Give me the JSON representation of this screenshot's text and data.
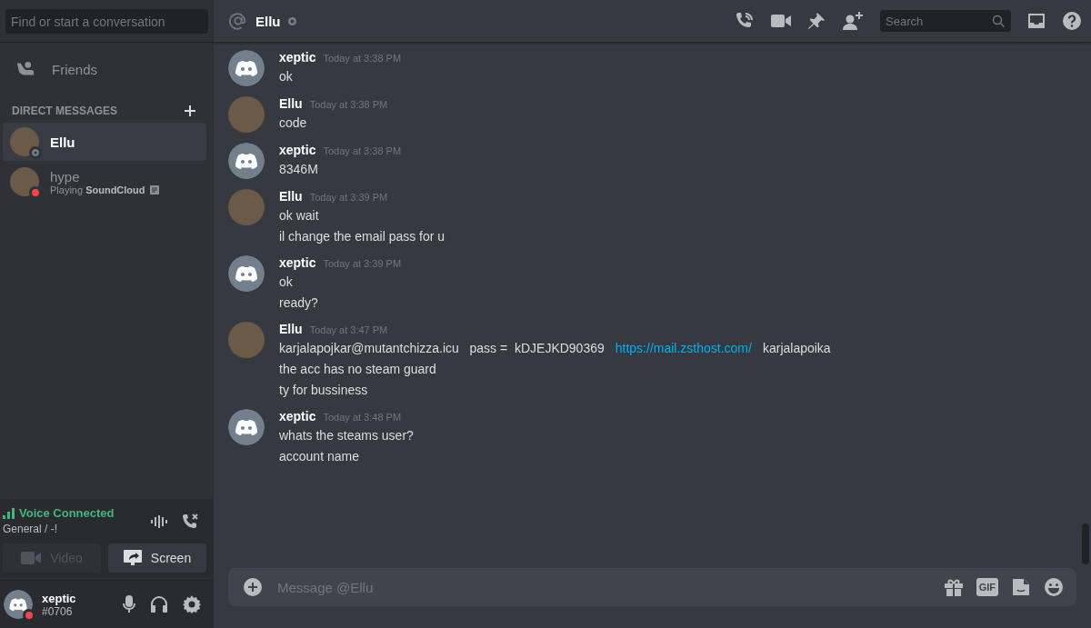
{
  "sidebar": {
    "search": {
      "placeholder": "Find or start a conversation"
    },
    "friends": {
      "label": "Friends",
      "selected": false
    },
    "dm_heading": "DIRECT MESSAGES",
    "dms": [
      {
        "name": "Ellu",
        "offline": true,
        "dnd": false,
        "selected": true
      },
      {
        "name": "hype",
        "offline": false,
        "dnd": true,
        "selected": false,
        "activity_prefix": "Playing",
        "activity": "SoundCloud"
      }
    ],
    "voice": {
      "title": "Voice Connected",
      "channel": "General / -!",
      "buttons": [
        {
          "label": "Video",
          "kind": "video",
          "disabled": true
        },
        {
          "label": "Screen",
          "kind": "screen",
          "disabled": false
        }
      ]
    },
    "user": {
      "name": "xeptic",
      "tag": "#0706",
      "dnd": true
    }
  },
  "header": {
    "name": "Ellu",
    "offline": true,
    "search_placeholder": "Search"
  },
  "messages": [
    {
      "author": "xeptic",
      "photo_avatar": false,
      "time": "Today at 3:38 PM",
      "lines": [
        {
          "text": "ok"
        }
      ]
    },
    {
      "author": "Ellu",
      "photo_avatar": true,
      "time": "Today at 3:38 PM",
      "lines": [
        {
          "text": "code"
        }
      ]
    },
    {
      "author": "xeptic",
      "photo_avatar": false,
      "time": "Today at 3:38 PM",
      "lines": [
        {
          "text": "8346M"
        }
      ]
    },
    {
      "author": "Ellu",
      "photo_avatar": true,
      "time": "Today at 3:39 PM",
      "lines": [
        {
          "text": "ok wait"
        },
        {
          "text": "il change the email pass for u"
        }
      ]
    },
    {
      "author": "xeptic",
      "photo_avatar": false,
      "time": "Today at 3:39 PM",
      "lines": [
        {
          "text": "ok"
        },
        {
          "text": "ready?"
        }
      ]
    },
    {
      "author": "Ellu",
      "photo_avatar": true,
      "time": "Today at 3:47 PM",
      "lines": [
        {
          "parts": [
            {
              "kind": "text",
              "text": "karjalapojkar@mutantchizza.icu   pass =  kDJEJKD90369"
            },
            {
              "kind": "link",
              "text": "https://mail.zsthost.com/"
            },
            {
              "kind": "text",
              "text": "karjalapoika"
            }
          ]
        },
        {
          "text": "the acc has no steam guard"
        },
        {
          "text": "ty for bussiness"
        }
      ]
    },
    {
      "author": "xeptic",
      "photo_avatar": false,
      "time": "Today at 3:48 PM",
      "lines": [
        {
          "text": "whats the steams user?"
        },
        {
          "text": "account name"
        }
      ]
    }
  ],
  "composer": {
    "placeholder": "Message @Ellu",
    "gif_label": "GIF"
  }
}
